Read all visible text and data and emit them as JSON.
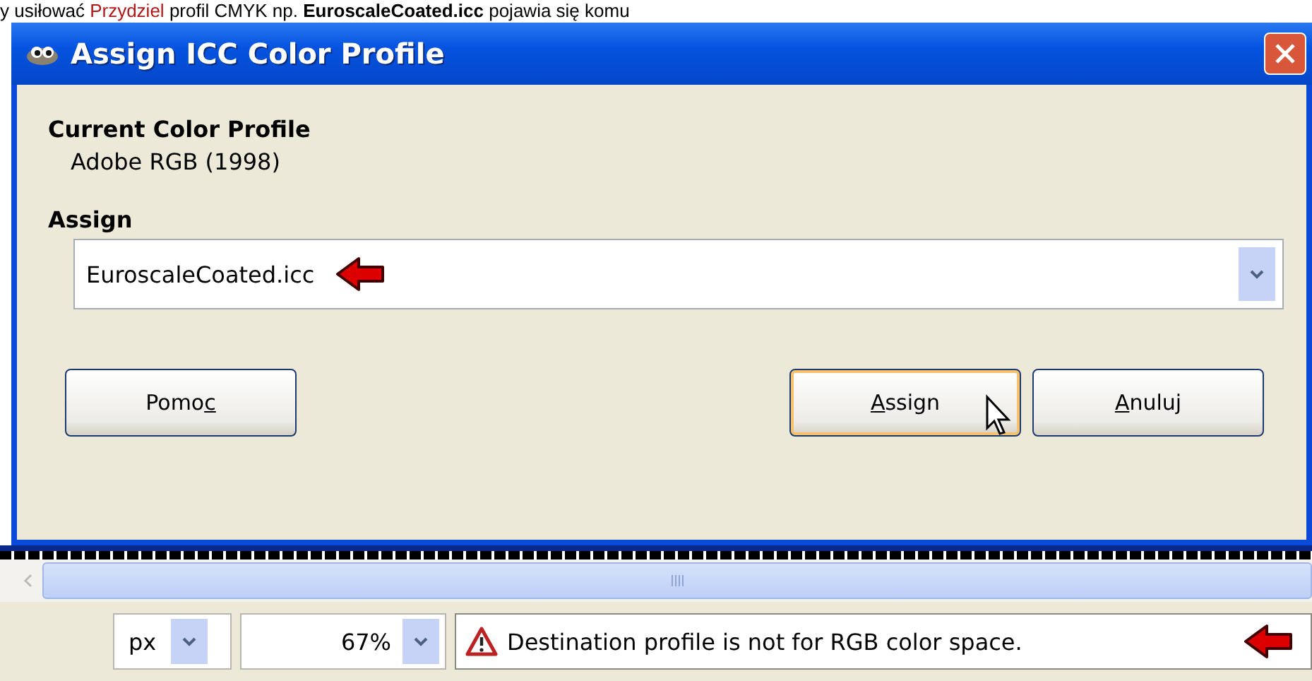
{
  "caption": [
    {
      "kind": "plain",
      "text": "y usiłować "
    },
    {
      "kind": "red",
      "text": "Przydziel"
    },
    {
      "kind": "plain",
      "text": " profil CMYK np. "
    },
    {
      "kind": "bold",
      "text": "EuroscaleCoated.icc"
    },
    {
      "kind": "plain",
      "text": " pojawia się komu"
    }
  ],
  "window": {
    "title": "Assign ICC Color Profile"
  },
  "current_profile": {
    "heading": "Current Color Profile",
    "value": "Adobe RGB (1998)"
  },
  "assign": {
    "heading": "Assign",
    "value": "EuroscaleCoated.icc"
  },
  "buttons": [
    {
      "parts": [
        {
          "text": "Pomo",
          "underlined": false
        },
        {
          "text": "c",
          "underlined": true
        }
      ],
      "default": false
    },
    {
      "parts": [
        {
          "text": "A",
          "underlined": true
        },
        {
          "text": "ssign",
          "underlined": false
        }
      ],
      "default": true
    },
    {
      "parts": [
        {
          "text": "A",
          "underlined": true
        },
        {
          "text": "nuluj",
          "underlined": false
        }
      ],
      "default": false
    }
  ],
  "status_bar": {
    "unit": "px",
    "zoom": "67%",
    "message": "Destination profile is not for RGB color space."
  }
}
